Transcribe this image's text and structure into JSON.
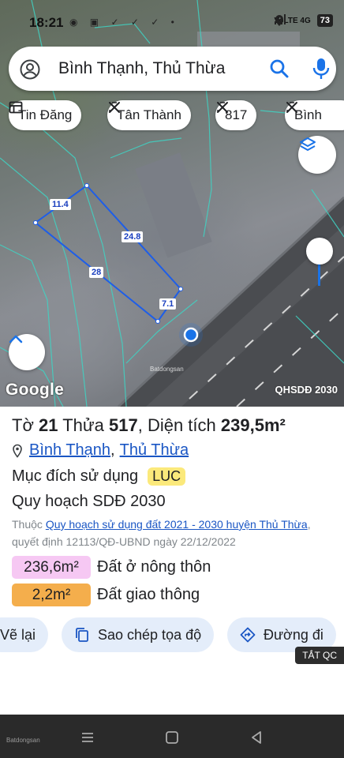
{
  "status_bar": {
    "time": "18:21",
    "notifications": "◉ ▣ ✓ ✓ ✓ •",
    "network": "VoLTE 4G",
    "battery": "73"
  },
  "search": {
    "query": "Bình Thạnh, Thủ Thừa"
  },
  "chips": [
    {
      "label": "Tin Đăng",
      "icon": "list-icon"
    },
    {
      "label": "Tân Thành",
      "icon": "close-x-icon"
    },
    {
      "label": "817",
      "icon": "close-x-icon"
    },
    {
      "label": "Bình",
      "icon": "close-x-icon"
    }
  ],
  "map": {
    "google_logo": "Google",
    "layer_label": "QHSDĐ 2030",
    "watermark": "Batdongsan",
    "dimensions": [
      "11.4",
      "24.8",
      "28",
      "7.1"
    ]
  },
  "parcel": {
    "to_label": "Tờ",
    "to_value": "21",
    "thua_label": "Thửa",
    "thua_value": "517",
    "area_label": "Diện tích",
    "area_value": "239,5m²",
    "commune": "Bình Thạnh",
    "district": "Thủ Thừa",
    "purpose_label": "Mục đích sử dụng",
    "purpose_code": "LUC",
    "plan_label": "Quy hoạch SDĐ 2030",
    "source_prefix": "Thuộc",
    "source_link": "Quy hoạch sử dụng đất 2021 - 2030 huyện Thủ Thừa",
    "source_suffix": ", quyết định 12113/QĐ-UBND ngày 22/12/2022",
    "land_uses": [
      {
        "area": "236,6m²",
        "label": "Đất ở nông thôn",
        "color": "#f6c8f3"
      },
      {
        "area": "2,2m²",
        "label": "Đất giao thông",
        "color": "#f4ae4c"
      }
    ]
  },
  "actions": {
    "redraw": "Vẽ lại",
    "copy_coords": "Sao chép tọa độ",
    "directions": "Đường đi",
    "tat_qc": "TẮT QC"
  },
  "nav": {
    "watermark": "Batdongsan"
  },
  "colors": {
    "accent": "#1a73e8",
    "link": "#1a56c4",
    "parcel": "#1e5ee8",
    "luc_badge": "#fbe97b"
  }
}
